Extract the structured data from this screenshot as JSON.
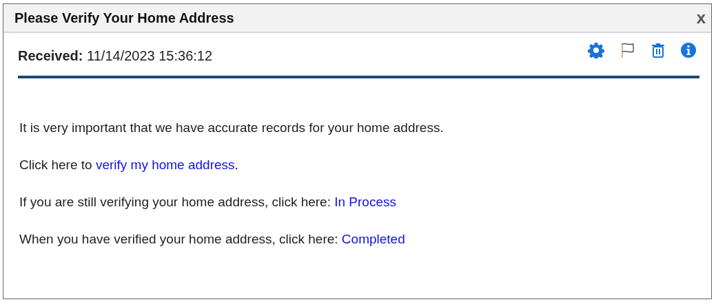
{
  "window": {
    "title": "Please Verify Your Home Address",
    "close": "x"
  },
  "header": {
    "label": "Received:",
    "value": "11/14/2023 15:36:12",
    "icons": [
      {
        "kind": "gear"
      },
      {
        "kind": "flag"
      },
      {
        "kind": "trash"
      },
      {
        "kind": "info"
      }
    ]
  },
  "paragraphs": [
    {
      "parts": [
        {
          "kind": "text",
          "text": "It is very important that we have accurate records for your home address."
        }
      ]
    },
    {
      "parts": [
        {
          "kind": "text",
          "text": "Click here to "
        },
        {
          "kind": "link",
          "text": "verify my home address"
        },
        {
          "kind": "text",
          "text": "."
        }
      ]
    },
    {
      "parts": [
        {
          "kind": "text",
          "text": "If you are still verifying your home address, click here: "
        },
        {
          "kind": "link",
          "text": "In Process"
        }
      ]
    },
    {
      "parts": [
        {
          "kind": "text",
          "text": "When you have verified your home address, click here: "
        },
        {
          "kind": "link",
          "text": "Completed"
        }
      ]
    }
  ]
}
